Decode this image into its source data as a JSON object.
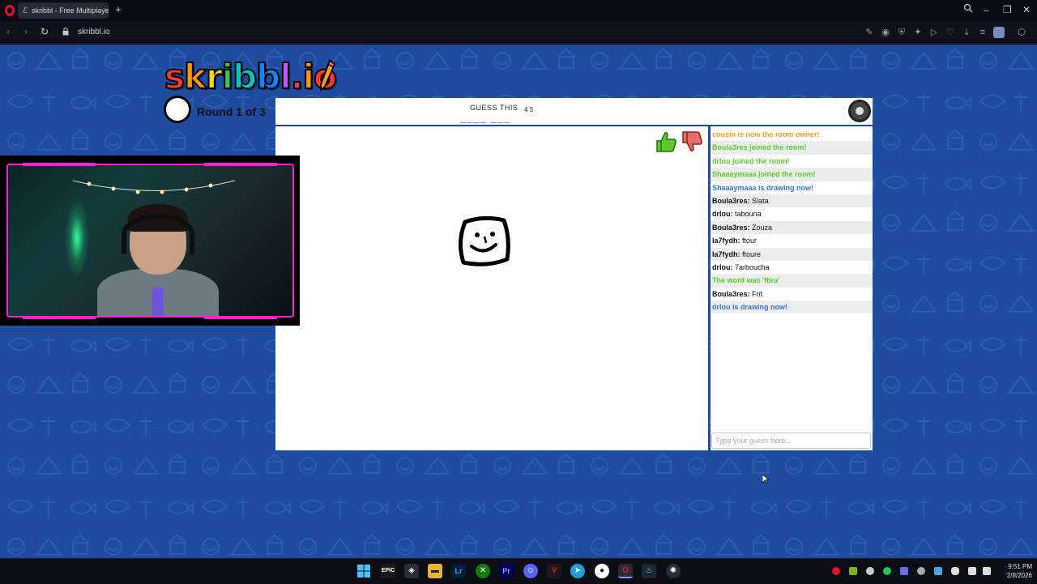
{
  "browser": {
    "tab_title": "skribbl - Free Multiplayer",
    "url": "skribbl.io"
  },
  "game": {
    "logo_letters": [
      "s",
      "k",
      "r",
      "i",
      "b",
      "b",
      "l",
      ".",
      "i",
      "o"
    ],
    "logo_colors": [
      "#ff3b30",
      "#ff9500",
      "#ffd60a",
      "#34c759",
      "#00c7be",
      "#0a84ff",
      "#bf5af2",
      "#ff375f",
      "#ff9500",
      "#ff3b30"
    ],
    "round_text": "Round 1 of 3",
    "guess_label": "GUESS THIS",
    "word_blanks": "____ ___",
    "word_count": "4 3"
  },
  "chat": {
    "messages": [
      {
        "user": "",
        "text": "cousin is now the room owner!",
        "color": "#f0a020",
        "bold": true
      },
      {
        "user": "",
        "text": "Boula3res joined the room!",
        "color": "#56ce27",
        "bold": true
      },
      {
        "user": "",
        "text": "drlou joined the room!",
        "color": "#56ce27",
        "bold": true
      },
      {
        "user": "",
        "text": "Shaaaymaaa joined the room!",
        "color": "#56ce27",
        "bold": true
      },
      {
        "user": "",
        "text": "Shaaaymaaa is drawing now!",
        "color": "#3975ce",
        "bold": true
      },
      {
        "user": "Boula3res:",
        "text": "Slata",
        "color": "#111111",
        "bold": false
      },
      {
        "user": "drlou:",
        "text": "tabouna",
        "color": "#111111",
        "bold": false
      },
      {
        "user": "Boula3res:",
        "text": "Zouza",
        "color": "#111111",
        "bold": false
      },
      {
        "user": "la7fydh:",
        "text": "ftour",
        "color": "#111111",
        "bold": false
      },
      {
        "user": "la7fydh:",
        "text": "ftoure",
        "color": "#111111",
        "bold": false
      },
      {
        "user": "drlou:",
        "text": "7arboucha",
        "color": "#111111",
        "bold": false
      },
      {
        "user": "",
        "text": "The word was 'ftira'",
        "color": "#56ce27",
        "bold": true
      },
      {
        "user": "Boula3res:",
        "text": "Frit",
        "color": "#111111",
        "bold": false
      },
      {
        "user": "",
        "text": "drlou is drawing now!",
        "color": "#3975ce",
        "bold": true
      }
    ],
    "input_placeholder": "Type your guess here..."
  },
  "taskbar": {
    "time": "9:51 PM",
    "date": "2/8/2026"
  },
  "colors": {
    "background_blue": "#1f4c9e",
    "stream_frame": "#ff1fd6"
  }
}
